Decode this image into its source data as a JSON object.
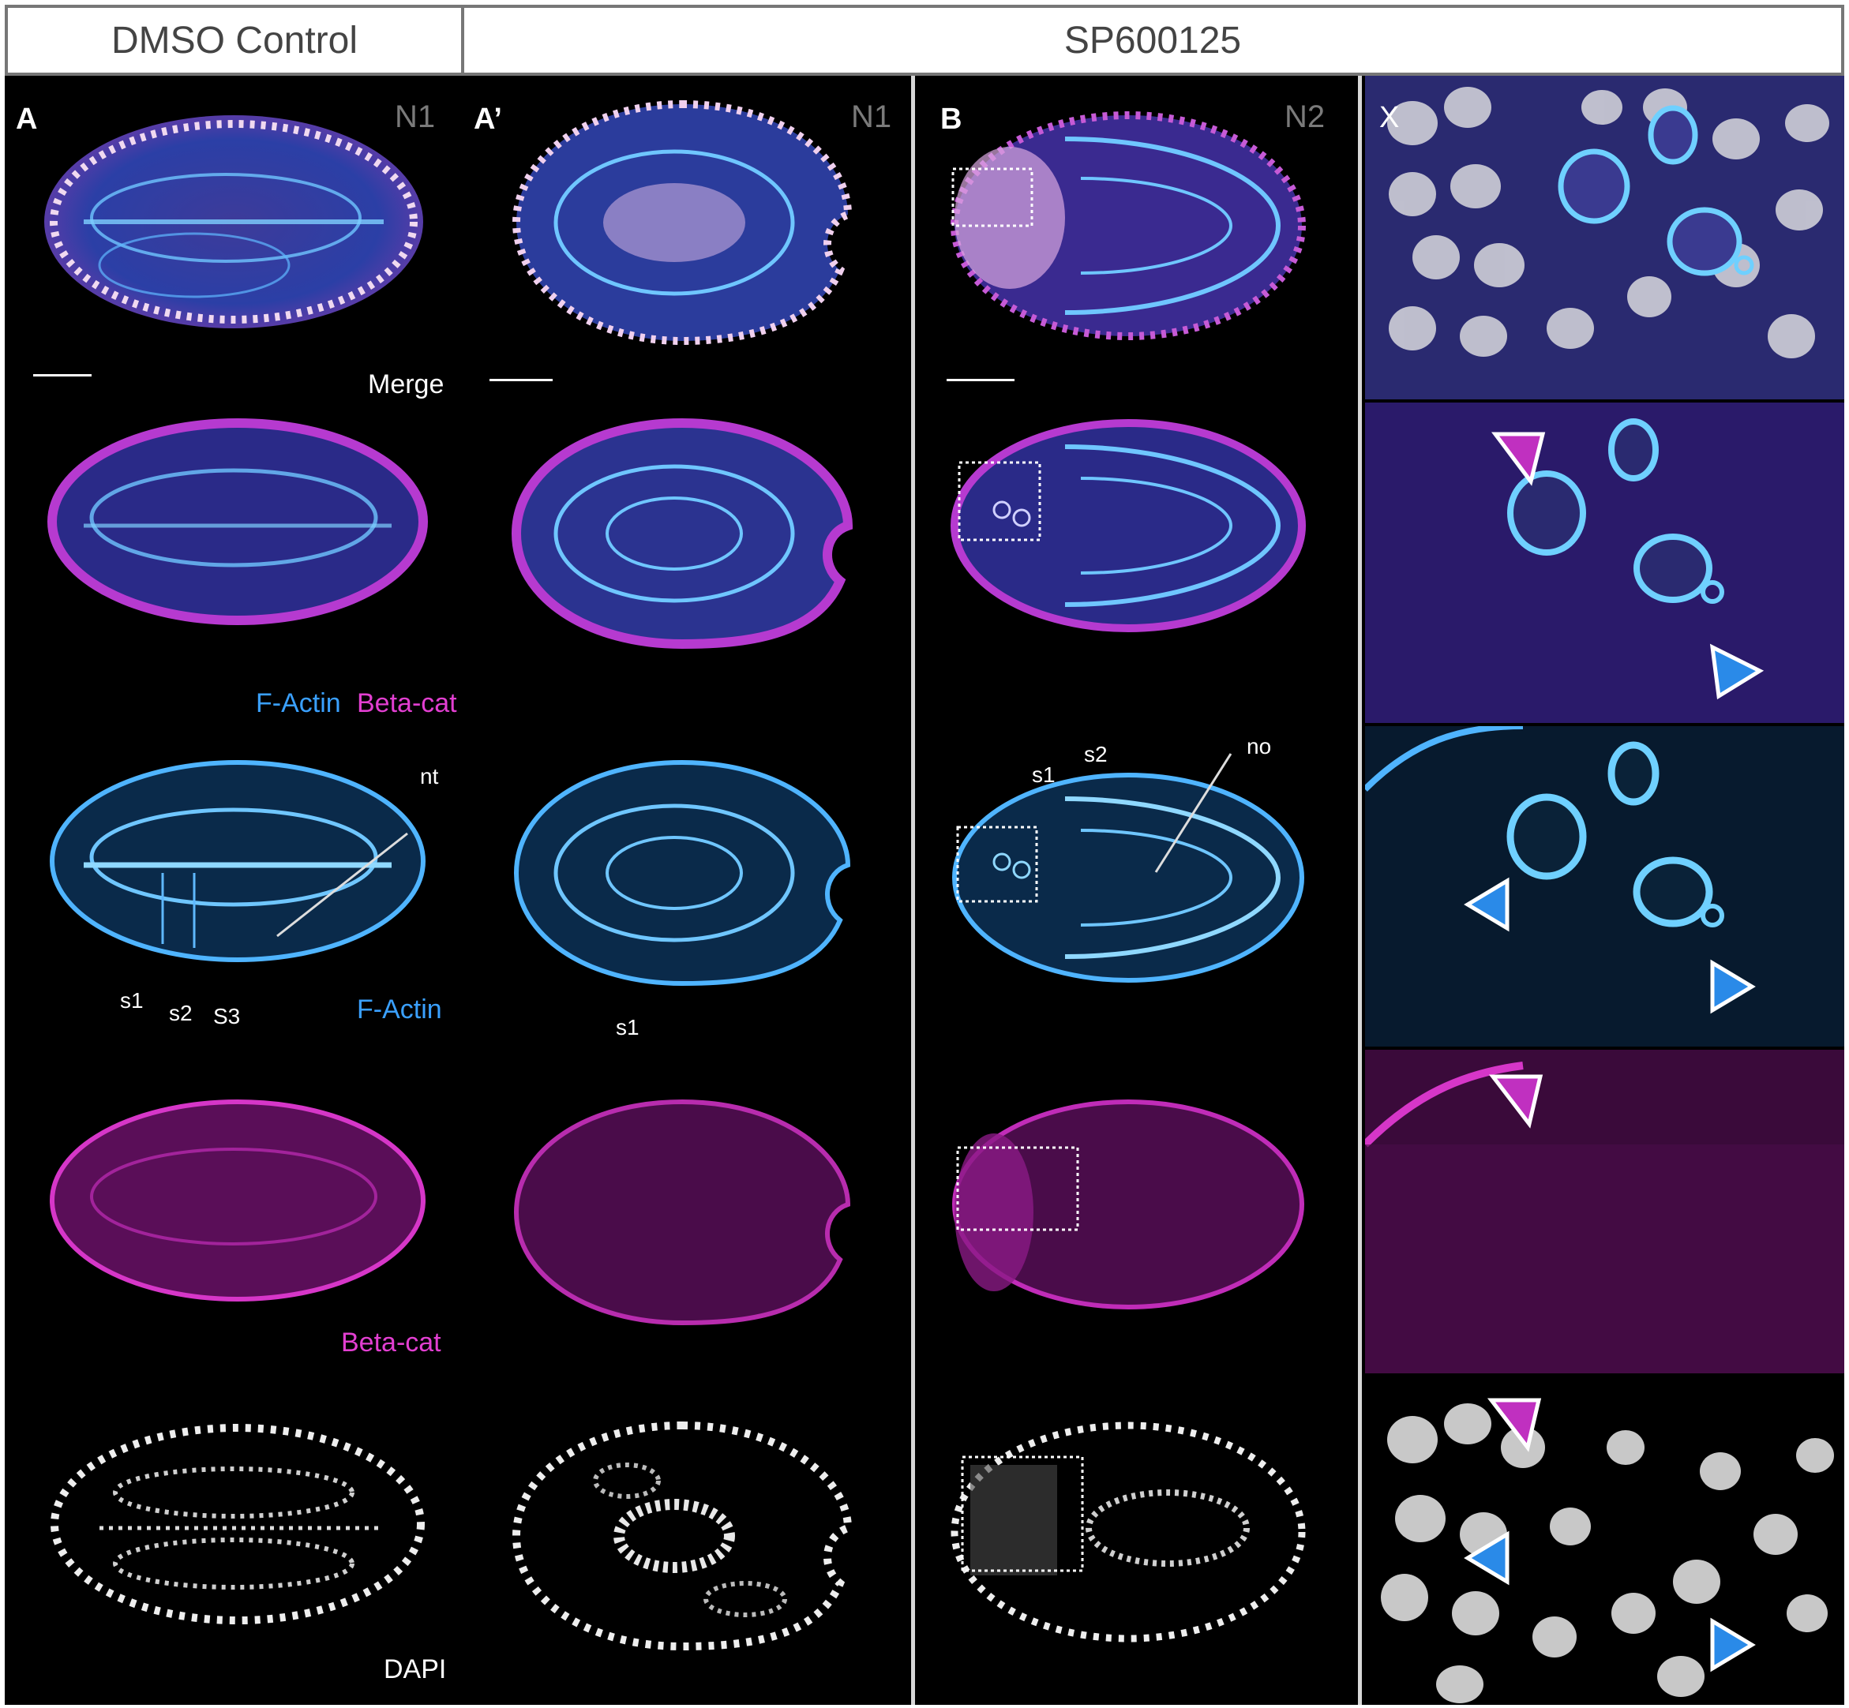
{
  "header": {
    "left": "DMSO Control",
    "right": "SP600125"
  },
  "panels": {
    "A": {
      "letter": "A",
      "n": "N1",
      "merge": "Merge",
      "fa": "F-Actin",
      "bc": "Beta-cat",
      "fa_only": "F-Actin",
      "bc_only": "Beta-cat",
      "dapi": "DAPI",
      "nt": "nt",
      "s1": "s1",
      "s2": "s2",
      "s3": "S3"
    },
    "A2": {
      "letter": "A’",
      "n": "N1",
      "s1": "s1"
    },
    "B": {
      "letter": "B",
      "n": "N2",
      "s1": "s1",
      "s2": "s2",
      "no": "no"
    },
    "X": {
      "letter": "X"
    }
  },
  "colors": {
    "factin": "#3aa0ff",
    "betacat": "#e23fd1",
    "dapi": "#e8e8e8",
    "background": "#000000",
    "header_border": "#777777"
  }
}
